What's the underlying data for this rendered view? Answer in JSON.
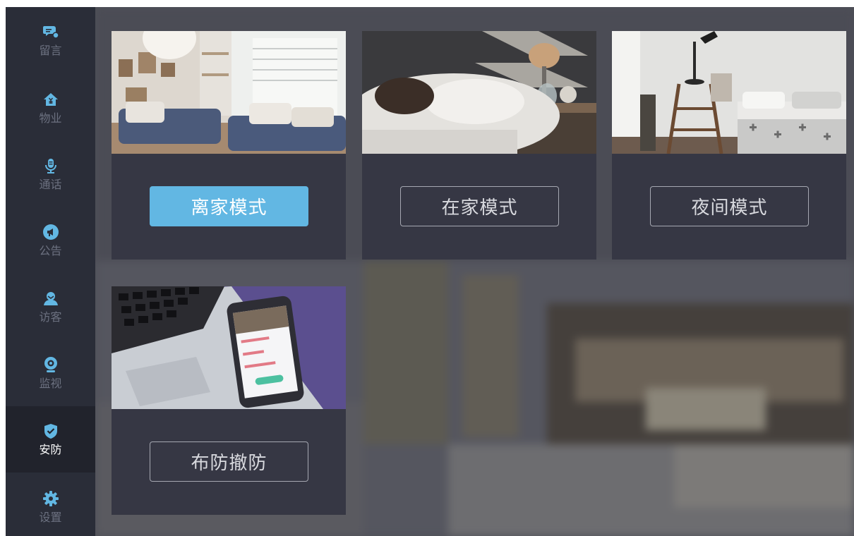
{
  "sidebar": {
    "items": [
      {
        "label": "留言",
        "icon": "message-icon",
        "active": false
      },
      {
        "label": "物业",
        "icon": "property-home-icon",
        "active": false
      },
      {
        "label": "通话",
        "icon": "microphone-icon",
        "active": false
      },
      {
        "label": "公告",
        "icon": "megaphone-icon",
        "active": false
      },
      {
        "label": "访客",
        "icon": "visitor-icon",
        "active": false
      },
      {
        "label": "监视",
        "icon": "camera-icon",
        "active": false
      },
      {
        "label": "安防",
        "icon": "shield-check-icon",
        "active": true
      },
      {
        "label": "设置",
        "icon": "gear-icon",
        "active": false
      }
    ]
  },
  "modes": [
    {
      "label": "离家模式",
      "active": true,
      "photo": "living-room-photo"
    },
    {
      "label": "在家模式",
      "active": false,
      "photo": "sleeping-person-photo"
    },
    {
      "label": "夜间模式",
      "active": false,
      "photo": "bedroom-lamp-photo"
    },
    {
      "label": "布防撤防",
      "active": false,
      "photo": "phone-laptop-photo"
    }
  ],
  "colors": {
    "sidebar_bg": "#2a2d38",
    "sidebar_active_bg": "#21232c",
    "icon_accent": "#62b7e3",
    "card_bg": "#363744",
    "active_button": "#62b7e3"
  }
}
